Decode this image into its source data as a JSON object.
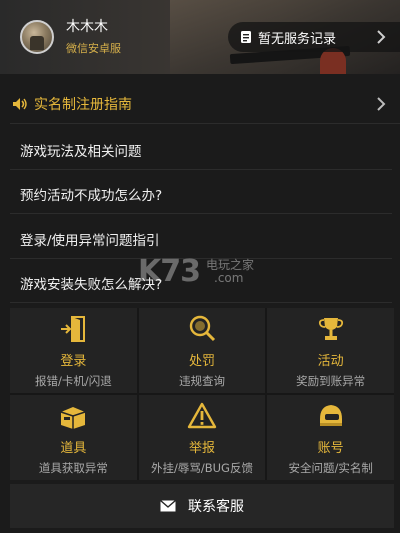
{
  "header": {
    "user_name": "木木木",
    "user_sub": "微信安卓服",
    "service_label": "暂无服务记录"
  },
  "notice": {
    "label": "实名制注册指南"
  },
  "faq": [
    {
      "label": "游戏玩法及相关问题"
    },
    {
      "label": "预约活动不成功怎么办?"
    },
    {
      "label": "登录/使用异常问题指引"
    },
    {
      "label": "游戏安装失败怎么解决?"
    }
  ],
  "categories": [
    {
      "title": "登录",
      "sub": "报错/卡机/闪退",
      "icon": "door-exit-icon"
    },
    {
      "title": "处罚",
      "sub": "违规查询",
      "icon": "magnifier-icon"
    },
    {
      "title": "活动",
      "sub": "奖励到账异常",
      "icon": "trophy-icon"
    },
    {
      "title": "道具",
      "sub": "道具获取异常",
      "icon": "supply-crate-icon"
    },
    {
      "title": "举报",
      "sub": "外挂/辱骂/BUG反馈",
      "icon": "warning-icon"
    },
    {
      "title": "账号",
      "sub": "安全问题/实名制",
      "icon": "helmet-icon"
    }
  ],
  "contact": {
    "label": "联系客服"
  },
  "watermark": {
    "logo": "K73",
    "line1": "电玩之家",
    "line2": ".com"
  },
  "colors": {
    "accent": "#e5b73b",
    "background": "#1b1b1b",
    "panel": "#232323"
  }
}
